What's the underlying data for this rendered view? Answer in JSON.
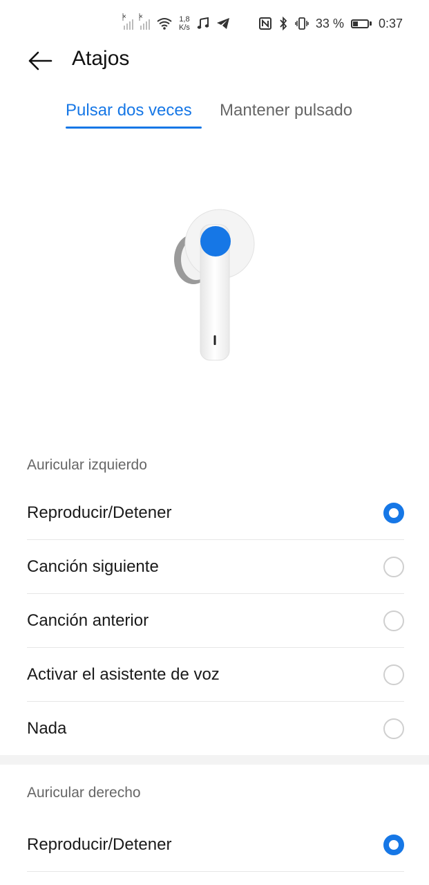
{
  "status_bar": {
    "network_speed_value": "1,8",
    "network_speed_unit": "K/s",
    "battery_percent": "33 %",
    "battery_level": 0.33,
    "time": "0:37"
  },
  "header": {
    "title": "Atajos"
  },
  "tabs": [
    {
      "label": "Pulsar dos veces",
      "active": true
    },
    {
      "label": "Mantener pulsado",
      "active": false
    }
  ],
  "left_earbud": {
    "section_label": "Auricular izquierdo",
    "options": [
      {
        "label": "Reproducir/Detener",
        "selected": true
      },
      {
        "label": "Canción siguiente",
        "selected": false
      },
      {
        "label": "Canción anterior",
        "selected": false
      },
      {
        "label": "Activar el asistente de voz",
        "selected": false
      },
      {
        "label": "Nada",
        "selected": false
      }
    ]
  },
  "right_earbud": {
    "section_label": "Auricular derecho",
    "options": [
      {
        "label": "Reproducir/Detener",
        "selected": true
      }
    ]
  },
  "colors": {
    "accent": "#1677e6",
    "radio_border": "#cfcfcf"
  }
}
